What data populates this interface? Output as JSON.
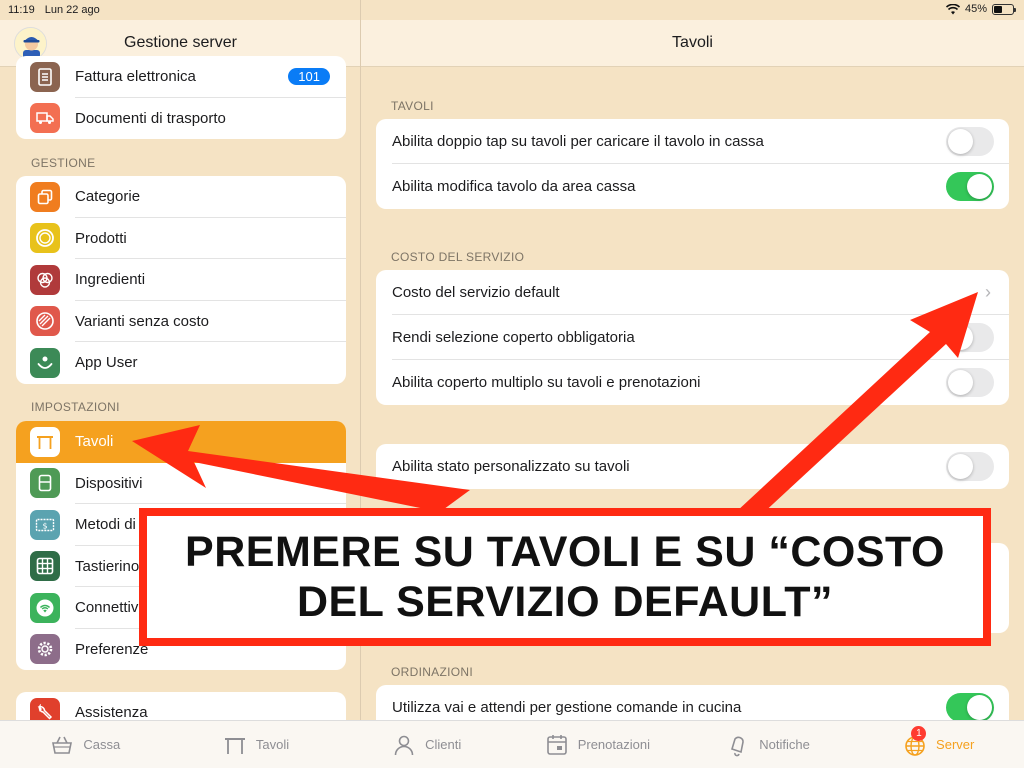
{
  "status_bar": {
    "time": "11:19",
    "date": "Lun 22 ago",
    "battery_text": "45%",
    "battery_level": 0.45
  },
  "sidebar": {
    "title": "Gestione server",
    "top_items": [
      {
        "label": "Fattura elettronica",
        "icon": "document-icon",
        "color": "#8b6450",
        "badge": "101"
      },
      {
        "label": "Documenti di trasporto",
        "icon": "truck-icon",
        "color": "#f36f52"
      }
    ],
    "gestione_label": "GESTIONE",
    "gestione_items": [
      {
        "label": "Categorie",
        "icon": "copy-icon",
        "color": "#f07d1f"
      },
      {
        "label": "Prodotti",
        "icon": "circle-icon",
        "color": "#e8c21b"
      },
      {
        "label": "Ingredienti",
        "icon": "venn-icon",
        "color": "#b03a3b"
      },
      {
        "label": "Varianti senza costo",
        "icon": "striped-circle-icon",
        "color": "#e0584b"
      },
      {
        "label": "App User",
        "icon": "smile-icon",
        "color": "#3c8a57"
      }
    ],
    "impostazioni_label": "IMPOSTAZIONI",
    "impostazioni_items": [
      {
        "label": "Tavoli",
        "icon": "table-icon",
        "color": "#ffffff",
        "active": true
      },
      {
        "label": "Dispositivi",
        "icon": "printer-icon",
        "color": "#4f9a56"
      },
      {
        "label": "Metodi di",
        "icon": "money-icon",
        "color": "#5ba3b0"
      },
      {
        "label": "Tastierino",
        "icon": "grid-icon",
        "color": "#2f6d47"
      },
      {
        "label": "Connettiv",
        "icon": "wifi-icon",
        "color": "#3cb35c"
      },
      {
        "label": "Preferenze",
        "icon": "gear-icon",
        "color": "#8d6d8a"
      }
    ],
    "support_items": [
      {
        "label": "Assistenza",
        "icon": "wrench-icon",
        "color": "#e0402c"
      }
    ]
  },
  "main": {
    "title": "Tavoli",
    "sections": {
      "tavoli_label": "TAVOLI",
      "tavoli_rows": [
        {
          "label": "Abilita doppio tap su tavoli per caricare il tavolo in cassa",
          "on": false
        },
        {
          "label": "Abilita modifica tavolo da area cassa",
          "on": true
        }
      ],
      "costo_label": "COSTO DEL SERVIZIO",
      "costo_rows": [
        {
          "label": "Costo del servizio default",
          "type": "chevron"
        },
        {
          "label": "Rendi selezione coperto obbligatoria",
          "on": false
        },
        {
          "label": "Abilita coperto multiplo su tavoli e prenotazioni",
          "on": false
        }
      ],
      "stato_rows": [
        {
          "label": "Abilita stato personalizzato su tavoli",
          "on": false
        }
      ],
      "ordinazioni_label": "ORDINAZIONI",
      "ordinazioni_rows": [
        {
          "label": "Utilizza vai e attendi per gestione comande in cucina",
          "on": true
        }
      ]
    }
  },
  "tabbar": {
    "tabs": [
      {
        "label": "Cassa",
        "icon": "basket-icon"
      },
      {
        "label": "Tavoli",
        "icon": "table-icon"
      },
      {
        "label": "Clienti",
        "icon": "person-icon"
      },
      {
        "label": "Prenotazioni",
        "icon": "calendar-icon"
      },
      {
        "label": "Notifiche",
        "icon": "bell-icon"
      },
      {
        "label": "Server",
        "icon": "globe-icon",
        "badge": "1",
        "active": true
      }
    ]
  },
  "annotation": {
    "line1": "PREMERE SU TAVOLI E SU “COSTO",
    "line2": "DEL SERVIZIO DEFAULT”",
    "color": "#ff2a12"
  },
  "colors": {
    "accent": "#f5a11f",
    "toggle_on": "#34c759",
    "badge_blue": "#0a7cf6"
  }
}
